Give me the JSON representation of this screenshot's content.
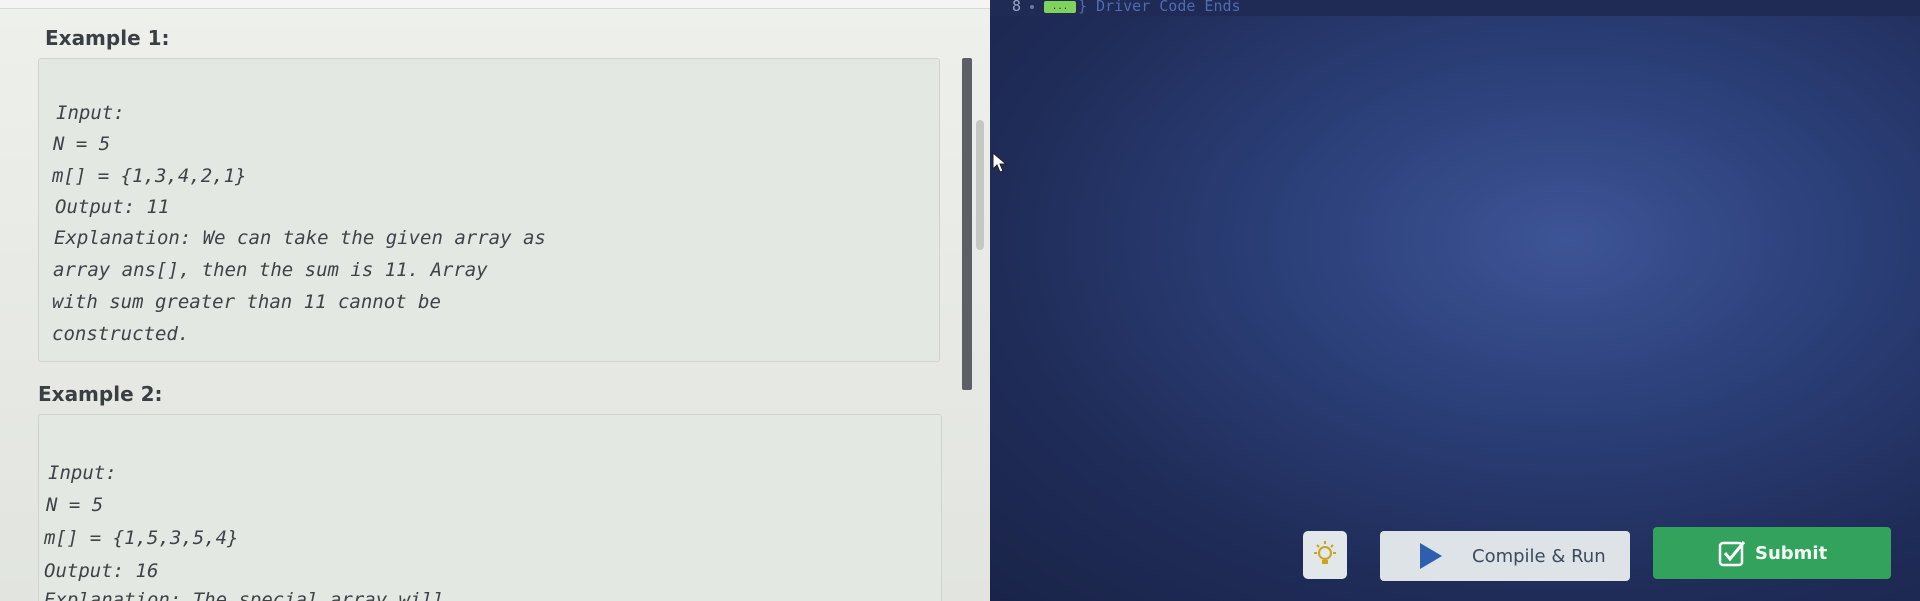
{
  "problem": {
    "example1": {
      "title": "Example 1:",
      "lines": [
        "Input:",
        "N = 5",
        "m[] = {1,3,4,2,1}",
        "Output: 11",
        "Explanation: We can take the given array as",
        "array ans[], then the sum is 11. Array",
        "with sum greater than 11 cannot be",
        "constructed."
      ]
    },
    "example2": {
      "title": "Example 2:",
      "lines": [
        "Input:",
        "N = 5",
        "m[] = {1,5,3,5,4}",
        "Output: 16",
        "Explanation: The special array will"
      ]
    }
  },
  "editor": {
    "line_number": "8",
    "fold_marker": "...",
    "comment": "} Driver Code Ends",
    "colors": {
      "background": "#2b3f78",
      "comment": "#4f6bb6",
      "fold_badge": "#7fd35c"
    }
  },
  "toolbar": {
    "hint_icon": "lightbulb-icon",
    "compile_run_label": "Compile & Run",
    "compile_run_icon": "play-icon",
    "submit_label": "Submit",
    "submit_icon": "checkbox-icon",
    "submit_color": "#33a25c"
  }
}
